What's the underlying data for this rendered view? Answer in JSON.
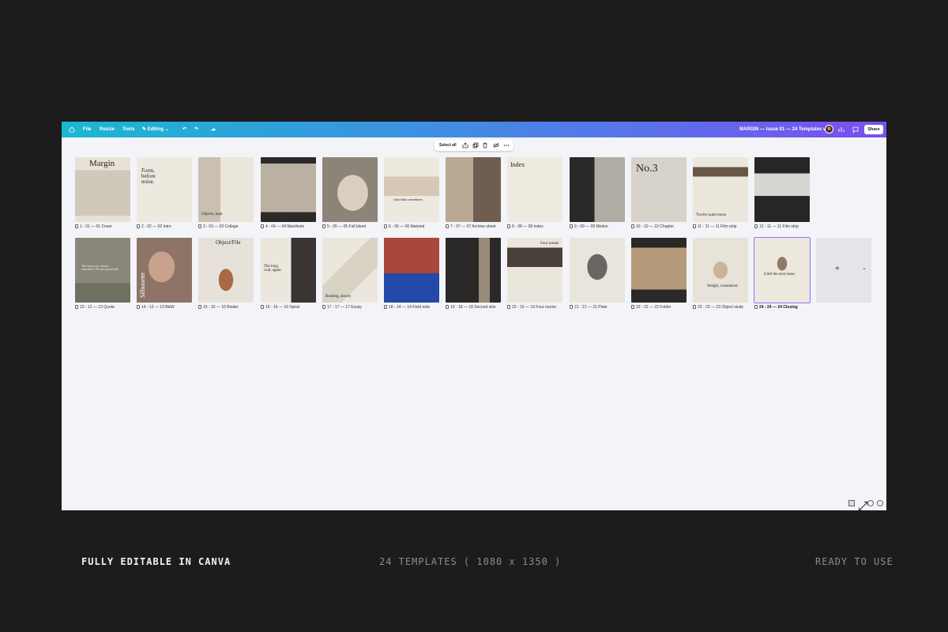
{
  "topbar": {
    "file": "File",
    "resize": "Resize",
    "tools": "Tools",
    "editing": "Editing",
    "doc_title": "MARGIN — Issue 01 — 24 Templates v3.1",
    "share": "Share"
  },
  "toolbar": {
    "select_all": "Select all"
  },
  "pages": [
    {
      "caption": "1 - 01 — 01 Cover",
      "text": "Margin",
      "bg": "#e8e2d6"
    },
    {
      "caption": "2 - 02 — 02 Intro",
      "text": "Form, before noise.",
      "bg": "#eee9df"
    },
    {
      "caption": "3 - 03 — 03 Collage",
      "text": "Objects, kept",
      "bg": "#ebe6dc"
    },
    {
      "caption": "4 - 04 — 04 Manifesto",
      "text": "",
      "bg": "#2b2a28"
    },
    {
      "caption": "5 - 05 — 05 Full bleed",
      "text": "",
      "bg": "#8d8479"
    },
    {
      "caption": "6 - 06 — 06 Material",
      "text": "what fabric remembers",
      "bg": "#eee9df"
    },
    {
      "caption": "7 - 07 — 07 Archive sheet",
      "text": "",
      "bg": "#eae5db"
    },
    {
      "caption": "8 - 08 — 08 Index",
      "text": "Index",
      "bg": "#efeae0"
    },
    {
      "caption": "9 - 09 — 09 Motion",
      "text": "",
      "bg": "#8a8580"
    },
    {
      "caption": "10 - 10 — 10 Chapter",
      "text": "No.3",
      "bg": "#d8d3ca"
    },
    {
      "caption": "11 - 11 — 11 Film strip",
      "text": "Twelve quiet hours",
      "bg": "#ece7dd"
    },
    {
      "caption": "12 - 11 — 11 Film strip",
      "text": "",
      "bg": "#262626"
    },
    {
      "caption": "13 - 12 — 12 Quote",
      "text": "The noise was always elsewhere. We just stood still.",
      "bg": "#8a877a"
    },
    {
      "caption": "14 - 13 — 13 B&W",
      "text": "Silhouette",
      "bg": "#8d7466"
    },
    {
      "caption": "15 - 15 — 15 Binder",
      "text": "Object/File",
      "bg": "#e6e2d9"
    },
    {
      "caption": "16 - 16 — 16 Spiral",
      "text": "The long coat, again",
      "bg": "#ece7dd"
    },
    {
      "caption": "17 - 17 — 17 Essay",
      "text": "Reading, slowly",
      "bg": "#ece7dd"
    },
    {
      "caption": "18 - 14 — 14 Field note",
      "text": "",
      "bg": "#a8473a"
    },
    {
      "caption": "19 - 18 — 18 Second skin",
      "text": "",
      "bg": "#2a2927"
    },
    {
      "caption": "20 - 19 — 19 Four rooms",
      "text": "Four rooms",
      "bg": "#ebe6dc"
    },
    {
      "caption": "21 - 21 — 21 Plate",
      "text": "",
      "bg": "#e9e5dc"
    },
    {
      "caption": "22 - 22 — 22 Folder",
      "text": "",
      "bg": "#2a2927"
    },
    {
      "caption": "23 - 23 — 23 Object study",
      "text": "Weight, considered",
      "bg": "#e8e3d8"
    },
    {
      "caption": "24 - 24 — 24 Closing",
      "text": "Until the next issue.",
      "bg": "#ede8de"
    }
  ],
  "footer": {
    "left": "FULLY EDITABLE IN CANVA",
    "center": "24 TEMPLATES ( 1080 x 1350 )",
    "right": "READY TO USE"
  }
}
